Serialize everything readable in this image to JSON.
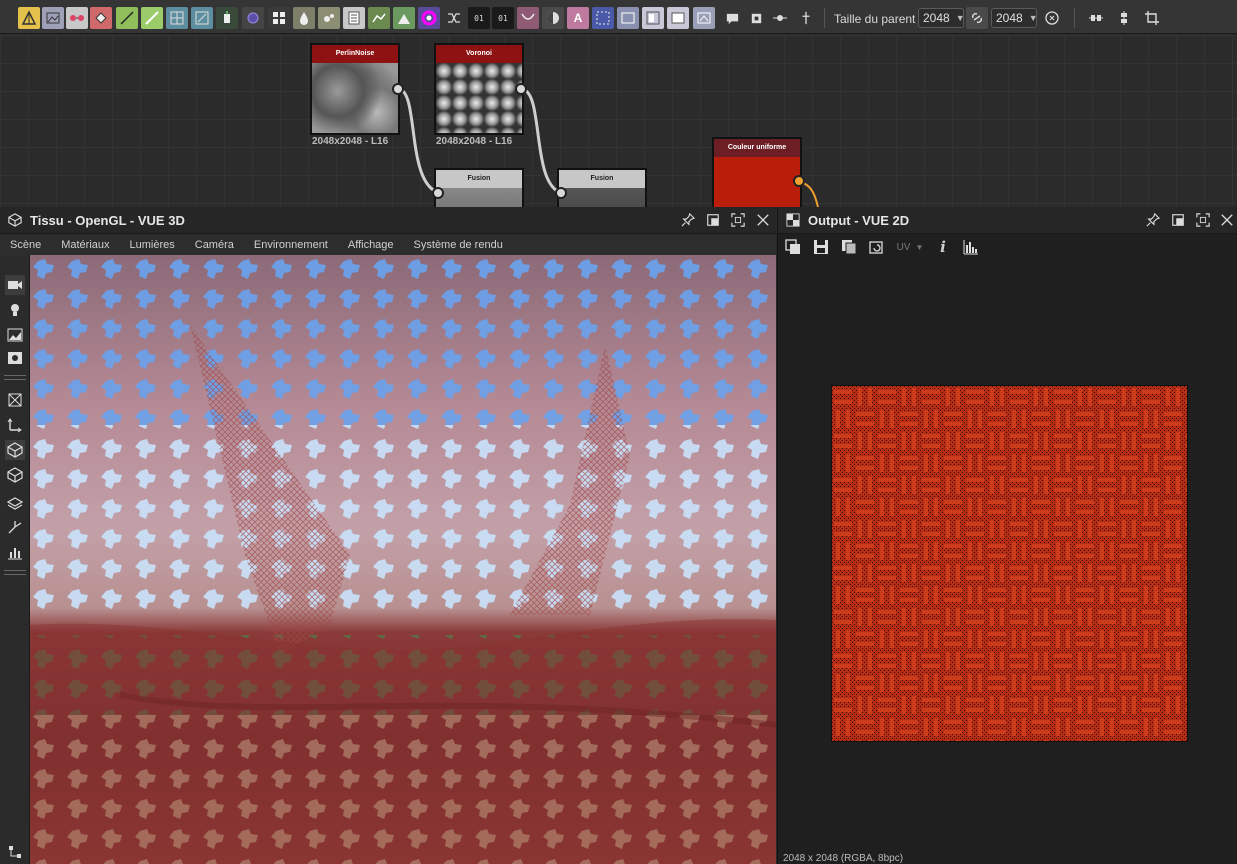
{
  "toolbar": {
    "parent_size_label": "Taille du parent :",
    "width_value": "2048",
    "height_value": "2048",
    "icons": [
      "curve-icon",
      "image-icon",
      "blend-icon",
      "fill-icon",
      "gradient-icon",
      "gradient-map-icon",
      "warp-icon",
      "transform-icon",
      "levels-icon",
      "shape-icon",
      "tile-icon",
      "drop-icon",
      "splatter-icon",
      "pattern-icon",
      "distance-icon",
      "histogram-icon",
      "color-wheel-icon",
      "shuffle-icon",
      "noise-01-icon",
      "noise-01b-icon",
      "mesh-icon",
      "contrast-icon",
      "text-icon",
      "frame-icon",
      "frame2-icon",
      "frame3-icon",
      "frame4-icon",
      "frame5-icon",
      "comment-icon",
      "link-node-icon",
      "dot-node-icon",
      "pin-node-icon",
      "link-icon",
      "reset-icon",
      "align-h-icon",
      "align-v-icon",
      "crop-icon"
    ],
    "accent_yellow": "#e3c14b",
    "accent_green": "#8fbe5a"
  },
  "graph": {
    "nodes": [
      {
        "title": "PerlinNoise",
        "caption": "2048x2048 - L16"
      },
      {
        "title": "Voronoi",
        "caption": "2048x2048 - L16"
      },
      {
        "title": "Fusion"
      },
      {
        "title": "Fusion"
      },
      {
        "title": "Couleur uniforme"
      }
    ]
  },
  "panel3d": {
    "title": "Tissu - OpenGL - VUE 3D",
    "menu": [
      "Scène",
      "Matériaux",
      "Lumières",
      "Caméra",
      "Environnement",
      "Affichage",
      "Système de rendu"
    ]
  },
  "panel2d": {
    "title": "Output - VUE 2D",
    "uv_label": "UV",
    "status": "2048 x 2048 (RGBA, 8bpc)"
  },
  "colors": {
    "node_header_red": "#8e1212",
    "uniform_color": "#b81e0a",
    "port_orange": "#f0a030"
  }
}
